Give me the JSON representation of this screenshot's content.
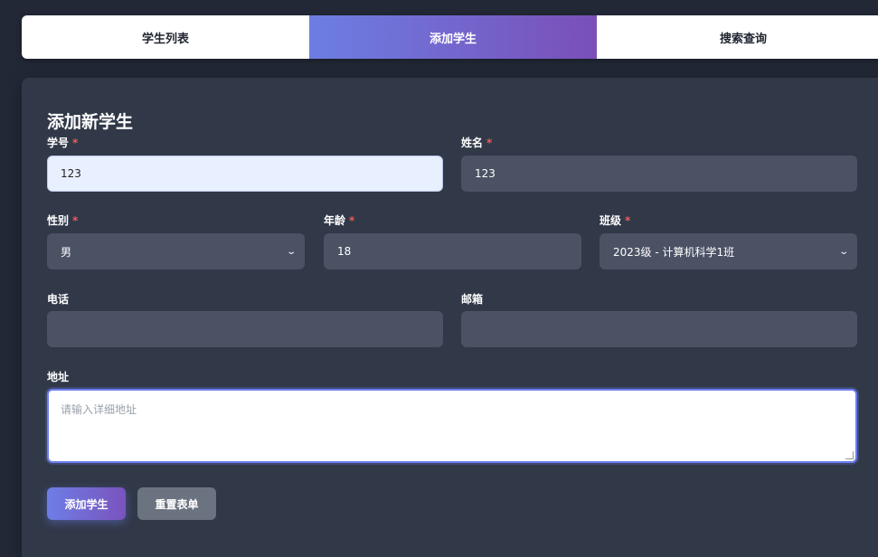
{
  "tabs": [
    {
      "label": "学生列表",
      "active": false
    },
    {
      "label": "添加学生",
      "active": true
    },
    {
      "label": "搜索查询",
      "active": false
    }
  ],
  "form": {
    "title": "添加新学生",
    "required_mark": "*",
    "student_id": {
      "label": "学号",
      "value": "123"
    },
    "name": {
      "label": "姓名",
      "value": "123"
    },
    "gender": {
      "label": "性别",
      "value": "男"
    },
    "age": {
      "label": "年龄",
      "value": "18"
    },
    "class": {
      "label": "班级",
      "value": "2023级 - 计算机科学1班"
    },
    "phone": {
      "label": "电话",
      "value": ""
    },
    "email": {
      "label": "邮箱",
      "value": ""
    },
    "address": {
      "label": "地址",
      "placeholder": "请输入详细地址"
    },
    "submit_label": "添加学生",
    "reset_label": "重置表单"
  },
  "colors": {
    "accent_start": "#6c7ee3",
    "accent_end": "#7a4fb8",
    "required": "#ef5b5b",
    "panel": "#313848",
    "background": "#222836"
  },
  "icons": {
    "select_arrow": "chevron-down-icon"
  }
}
